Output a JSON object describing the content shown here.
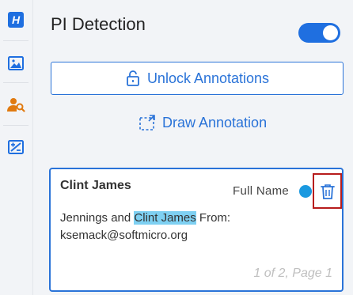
{
  "header": {
    "title": "PI Detection",
    "toggle_state": "on"
  },
  "rail": {
    "items": [
      {
        "icon": "h-logo-icon",
        "glyph": "H"
      },
      {
        "icon": "image-icon"
      },
      {
        "icon": "person-search-icon"
      },
      {
        "icon": "image-edit-icon"
      }
    ]
  },
  "actions": {
    "unlock_label": "Unlock Annotations",
    "draw_label": "Draw Annotation"
  },
  "card": {
    "name": "Clint James",
    "type": "Full Name",
    "text_before": "Jennings and ",
    "text_highlight": "Clint James",
    "text_after": " From: ksemack@softmicro.org",
    "page_info": "1 of 2, Page 1"
  },
  "colors": {
    "accent": "#2a73d8",
    "type_dot": "#1a99e0",
    "highlight": "#7ed0f2",
    "delete_frame": "#b71c1c",
    "person_icon": "#e07a10"
  }
}
